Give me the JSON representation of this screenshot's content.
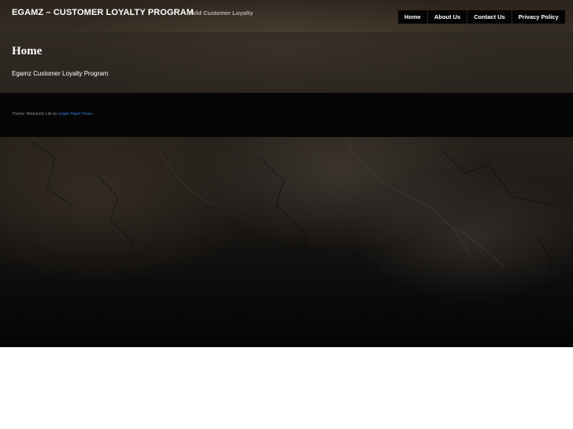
{
  "header": {
    "site_title": "EGAMZ – CUSTOMER LOYALTY PROGRAM",
    "tagline": "Build Customer Loyalty"
  },
  "nav": {
    "items": [
      {
        "label": "Home"
      },
      {
        "label": "About Us"
      },
      {
        "label": "Contact Us"
      },
      {
        "label": "Privacy Policy"
      }
    ]
  },
  "main": {
    "heading": "Home",
    "body_text": "Egamz Customer Loyalty Program"
  },
  "footer": {
    "credit_prefix": "Theme: Modularity Lite by ",
    "credit_link": "Graph Paper Press",
    "credit_suffix": "."
  },
  "colors": {
    "link": "#3a7bd5",
    "nav_background": "#050505",
    "footer_background": "#050505"
  }
}
